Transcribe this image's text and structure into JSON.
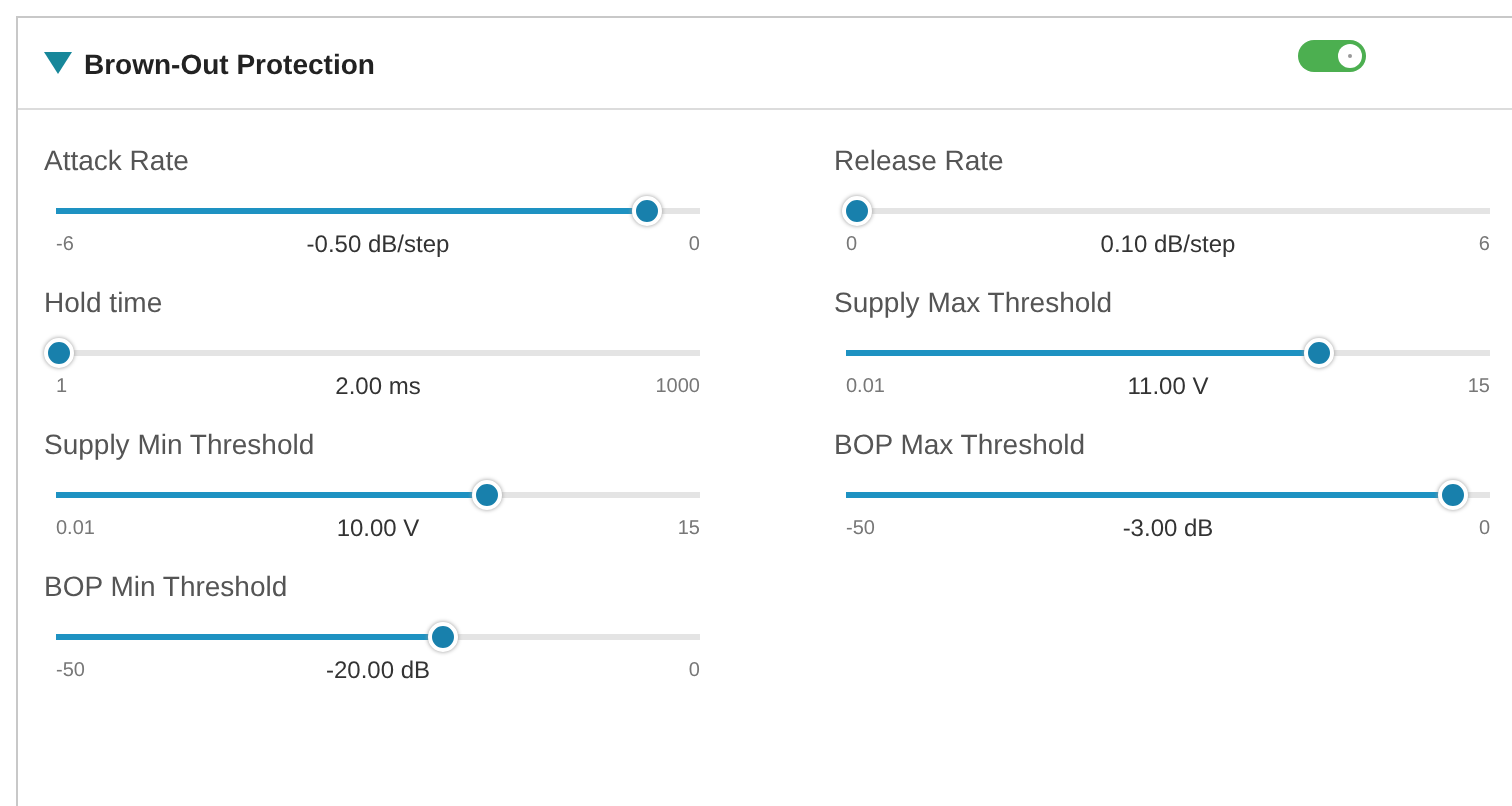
{
  "panel": {
    "title": "Brown-Out Protection",
    "expanded": true,
    "enabled": true
  },
  "sliders": [
    {
      "label": "Attack Rate",
      "min": "-6",
      "max": "0",
      "reading": "-0.50 dB/step",
      "level": 0.917
    },
    {
      "label": "Release Rate",
      "min": "0",
      "max": "6",
      "reading": "0.10 dB/step",
      "level": 0.017
    },
    {
      "label": "Hold time",
      "min": "1",
      "max": "1000",
      "reading": "2.00 ms",
      "level": 0.002
    },
    {
      "label": "Supply Max Threshold",
      "min": "0.01",
      "max": "15",
      "reading": "11.00 V",
      "level": 0.733
    },
    {
      "label": "Supply Min Threshold",
      "min": "0.01",
      "max": "15",
      "reading": "10.00 V",
      "level": 0.667
    },
    {
      "label": "BOP Max Threshold",
      "min": "-50",
      "max": "0",
      "reading": "-3.00 dB",
      "level": 0.94
    },
    {
      "label": "BOP Min Threshold",
      "min": "-50",
      "max": "0",
      "reading": "-20.00 dB",
      "level": 0.6
    }
  ]
}
